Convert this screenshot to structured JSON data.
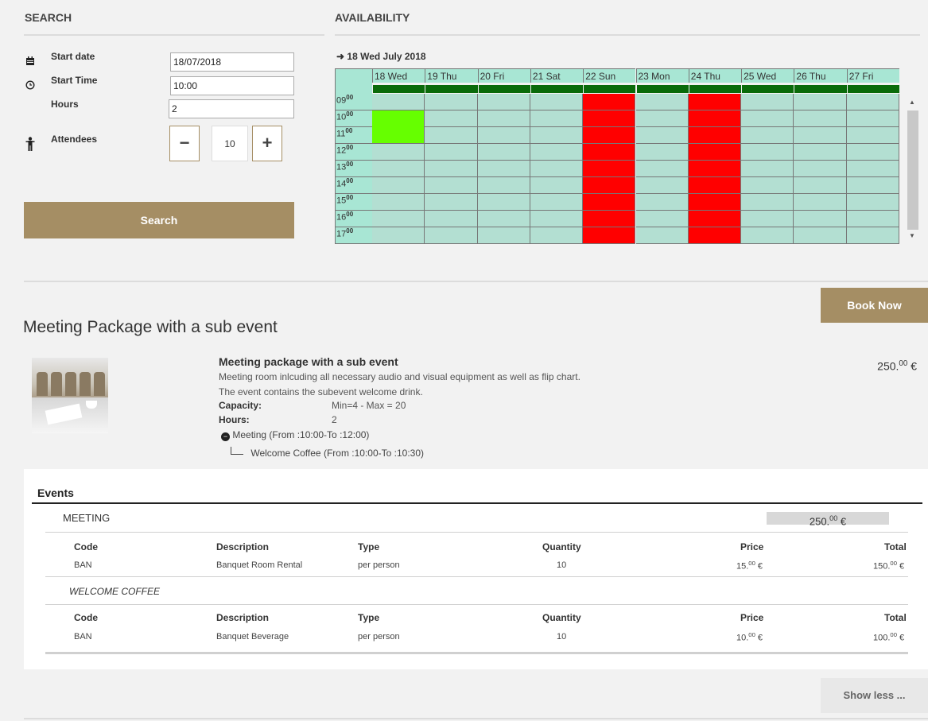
{
  "search": {
    "title": "SEARCH",
    "start_date_label": "Start date",
    "start_date_value": "18/07/2018",
    "start_time_label": "Start Time",
    "start_time_value": "10:00",
    "hours_label": "Hours",
    "hours_value": "2",
    "attendees_label": "Attendees",
    "attendees_value": "10",
    "minus": "−",
    "plus": "+",
    "search_button": "Search"
  },
  "availability": {
    "title": "AVAILABILITY",
    "nav_label": "18 Wed July 2018",
    "days": [
      "18 Wed",
      "19 Thu",
      "20 Fri",
      "21 Sat",
      "22 Sun",
      "23 Mon",
      "24 Thu",
      "25 Wed",
      "26 Thu",
      "27 Fri"
    ],
    "hours": [
      {
        "h": "09",
        "m": "00"
      },
      {
        "h": "10",
        "m": "00"
      },
      {
        "h": "11",
        "m": "00"
      },
      {
        "h": "12",
        "m": "00"
      },
      {
        "h": "13",
        "m": "00"
      },
      {
        "h": "14",
        "m": "00"
      },
      {
        "h": "15",
        "m": "00"
      },
      {
        "h": "16",
        "m": "00"
      },
      {
        "h": "17",
        "m": "00"
      }
    ],
    "unavailable_day_indexes": [
      4,
      6
    ],
    "selected": {
      "day_index": 0,
      "hour_start": "10",
      "hour_end": "12"
    },
    "colors": {
      "free": "#b3dfd2",
      "header": "#a8e6d4",
      "unavailable": "#ff0000",
      "selected": "#66ff00",
      "header_bar": "#0a6b0a"
    }
  },
  "book_now": "Book Now",
  "package": {
    "title": "Meeting Package with a sub event",
    "name": "Meeting package with a sub event",
    "desc1": "Meeting room inlcuding all necessary audio and visual equipment as well as flip chart.",
    "desc2": "The event contains the subevent welcome drink.",
    "capacity_label": "Capacity:",
    "capacity_value": "Min=4 - Max = 20",
    "hours_label": "Hours:",
    "hours_value": "2",
    "tree_main": "Meeting (From :10:00-To :12:00)",
    "tree_sub": "Welcome Coffee (From :10:00-To :10:30)",
    "price_main": "250.",
    "price_sup": "00",
    "price_cur": " €"
  },
  "events": {
    "title": "Events",
    "groups": [
      {
        "name": "MEETING",
        "total_main": "250.",
        "total_sup": "00",
        "total_cur": " €",
        "headers": [
          "Code",
          "Description",
          "Type",
          "Quantity",
          "Price",
          "Total"
        ],
        "rows": [
          {
            "code": "BAN",
            "description": "Banquet Room Rental",
            "type": "per person",
            "quantity": "10",
            "price_main": "15.",
            "price_sup": "00",
            "price_cur": " €",
            "total_main": "150.",
            "total_sup": "00",
            "total_cur": " €"
          }
        ]
      },
      {
        "name": "WELCOME COFFEE",
        "headers": [
          "Code",
          "Description",
          "Type",
          "Quantity",
          "Price",
          "Total"
        ],
        "rows": [
          {
            "code": "BAN",
            "description": "Banquet Beverage",
            "type": "per person",
            "quantity": "10",
            "price_main": "10.",
            "price_sup": "00",
            "price_cur": " €",
            "total_main": "100.",
            "total_sup": "00",
            "total_cur": " €"
          }
        ]
      }
    ]
  },
  "show_less": "Show less ..."
}
